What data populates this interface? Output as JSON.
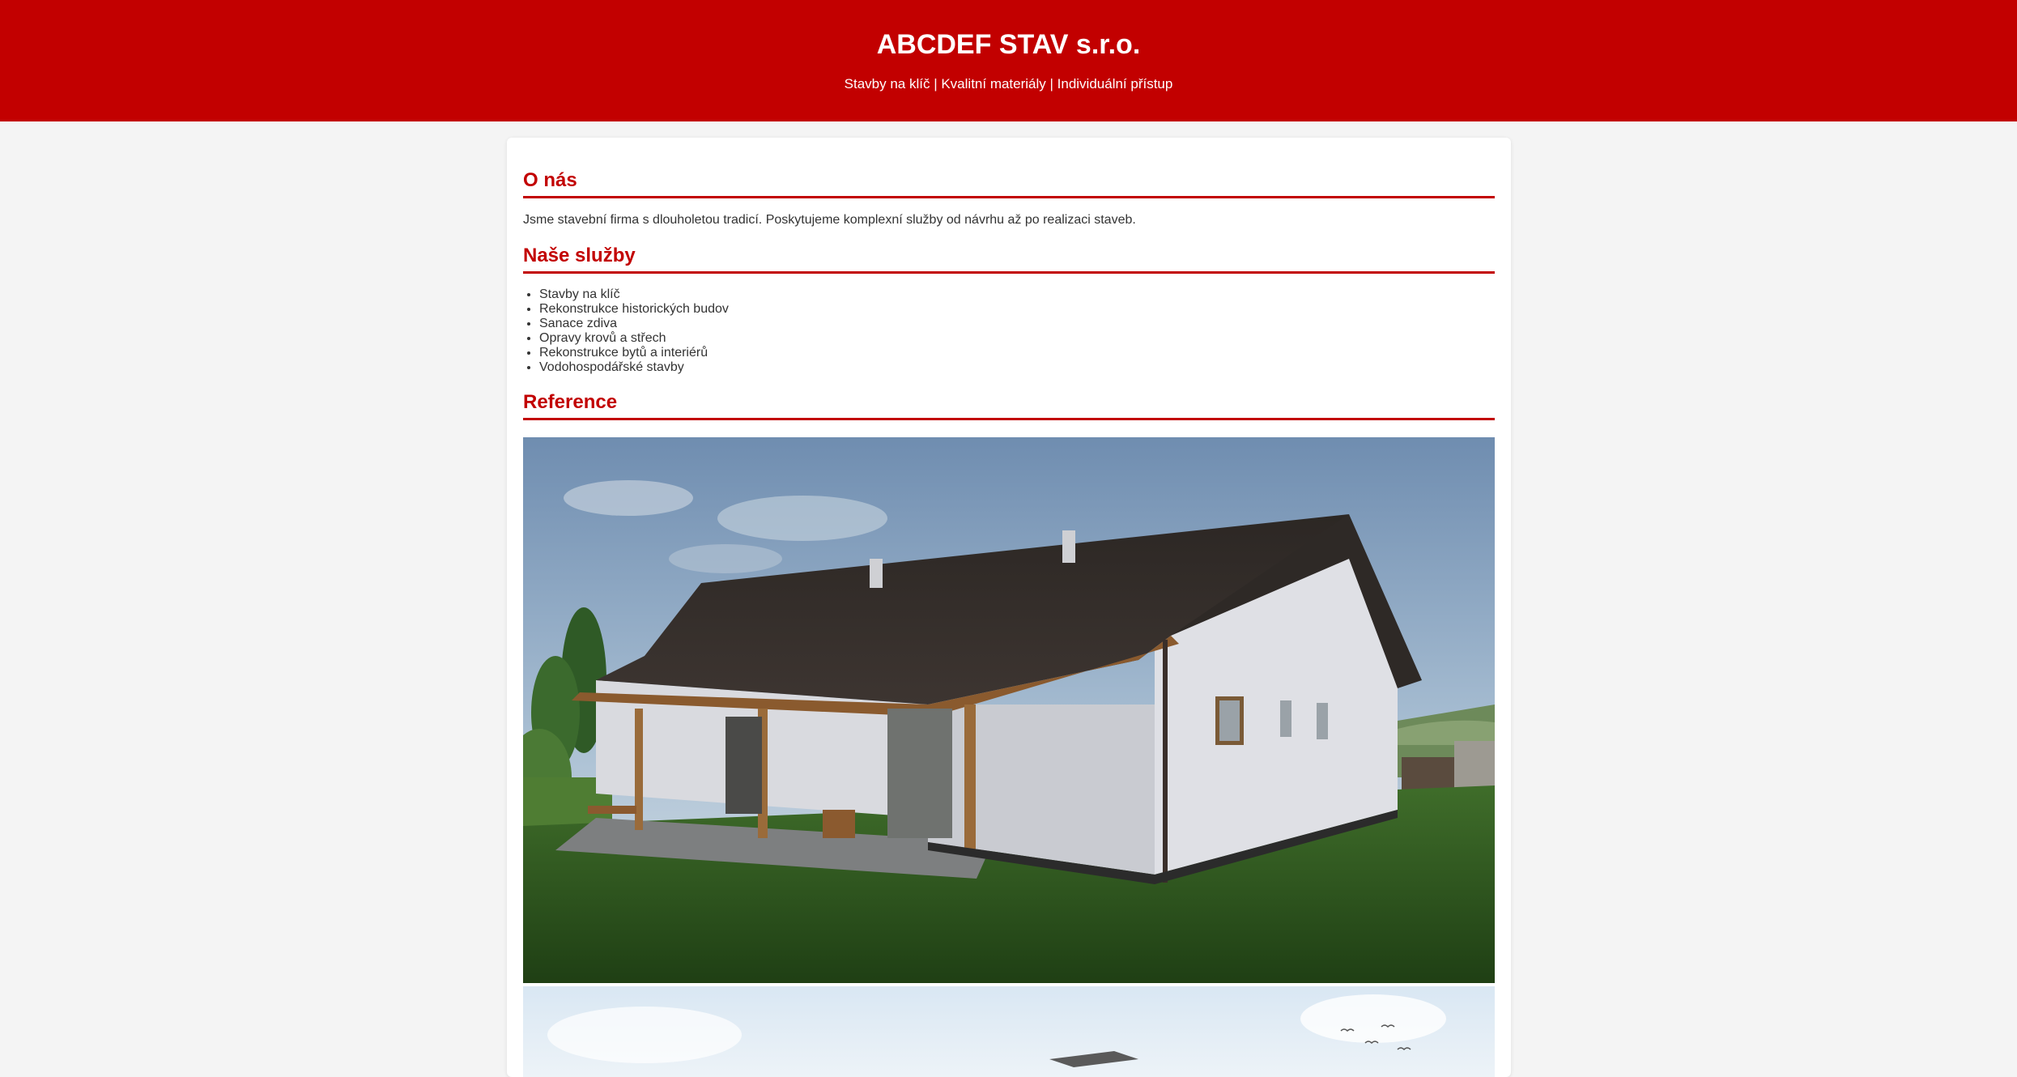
{
  "header": {
    "title": "ABCDEF STAV s.r.o.",
    "tagline": "Stavby na klíč | Kvalitní materiály | Individuální přístup"
  },
  "about": {
    "heading": "O nás",
    "text": "Jsme stavební firma s dlouholetou tradicí. Poskytujeme komplexní služby od návrhu až po realizaci staveb."
  },
  "services": {
    "heading": "Naše služby",
    "items": [
      "Stavby na klíč",
      "Rekonstrukce historických budov",
      "Sanace zdiva",
      "Opravy krovů a střech",
      "Rekonstrukce bytů a interiérů",
      "Vodohospodářské stavby"
    ]
  },
  "reference": {
    "heading": "Reference"
  },
  "colors": {
    "brand": "#c20000",
    "page_background": "#f4f4f4",
    "card_background": "#ffffff",
    "text": "#333333"
  }
}
